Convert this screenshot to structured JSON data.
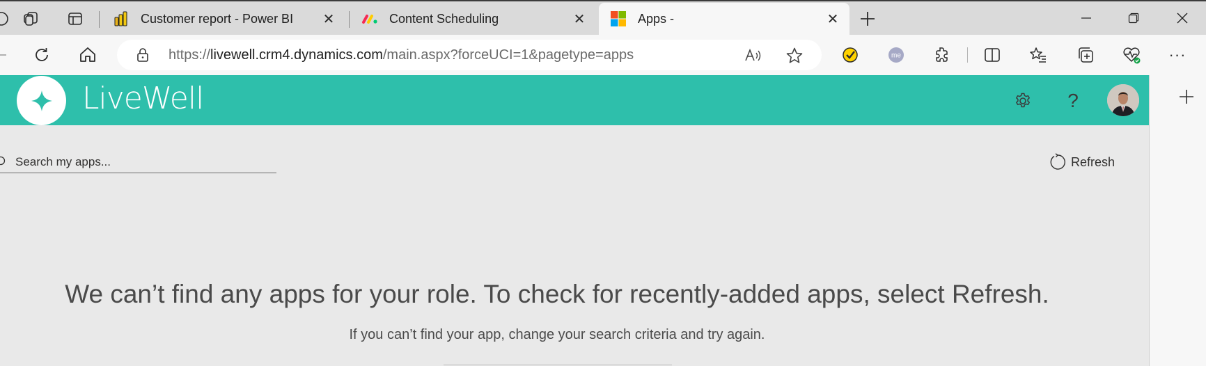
{
  "browser": {
    "tabs": [
      {
        "title": "Customer report - Power BI",
        "favicon": "power-bi-icon",
        "active": false
      },
      {
        "title": "Content Scheduling",
        "favicon": "monday-icon",
        "active": false
      },
      {
        "title": "Apps -",
        "favicon": "microsoft-icon",
        "active": true
      }
    ],
    "address": {
      "scheme": "https://",
      "host": "livewell.crm4.dynamics.com",
      "path": "/main.aspx?forceUCI=1&pagetype=apps"
    }
  },
  "app": {
    "brand": "LiveWell",
    "accent_color": "#2ebfab"
  },
  "content": {
    "search_placeholder": "Search my apps...",
    "refresh_label": "Refresh",
    "empty_title": "We can’t find any apps for your role. To check for recently-added apps, select Refresh.",
    "empty_subtitle": "If you can’t find your app, change your search criteria and try again."
  }
}
